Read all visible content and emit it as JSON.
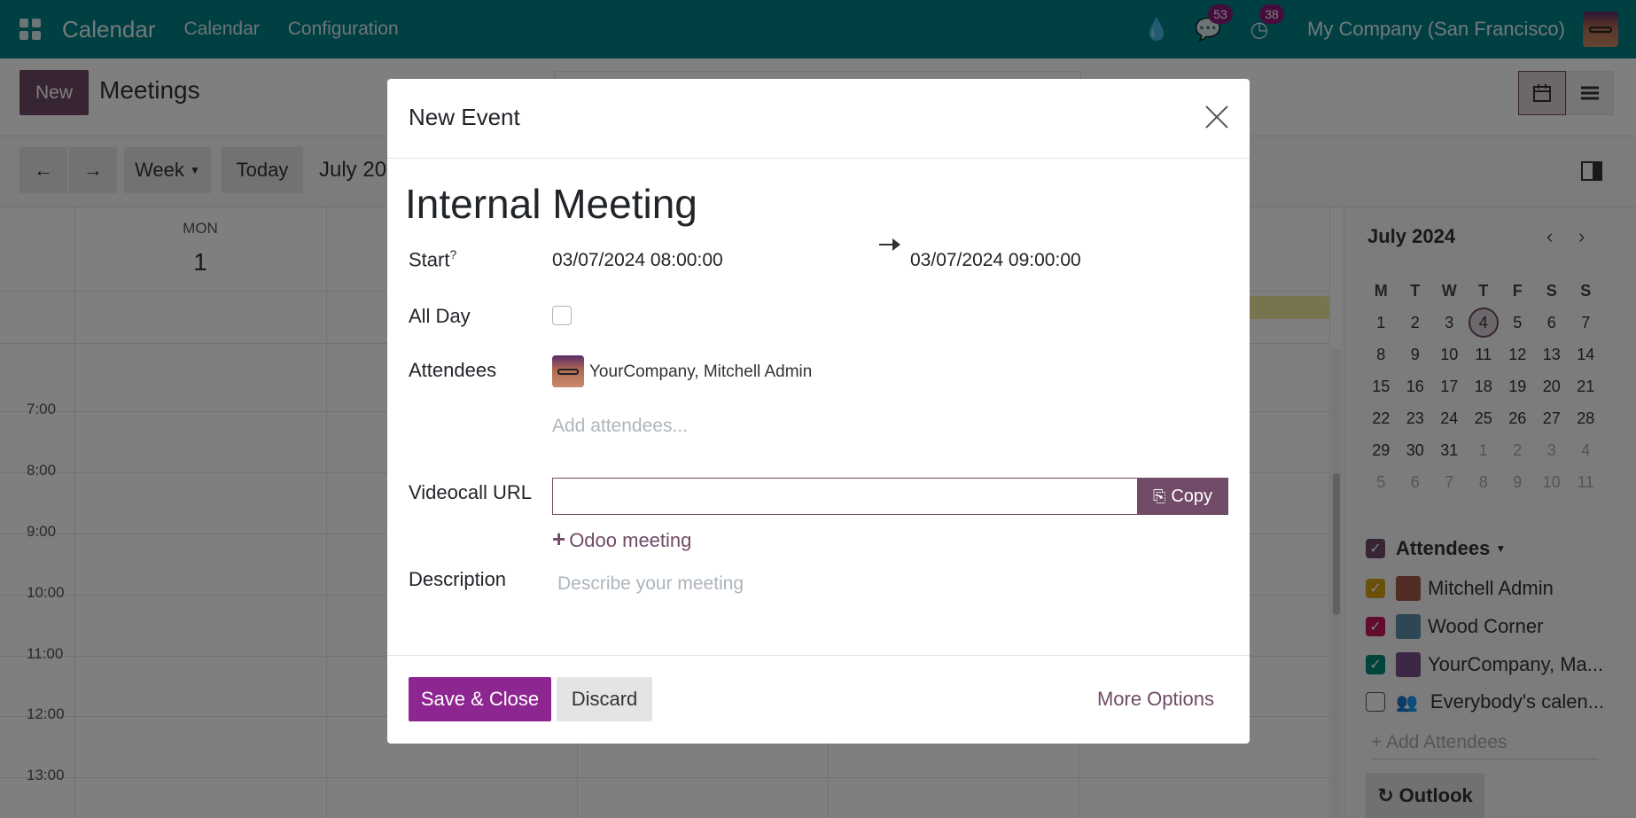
{
  "navbar": {
    "app_title": "Calendar",
    "links": [
      "Calendar",
      "Configuration"
    ],
    "messages_count": "53",
    "activities_count": "38",
    "company": "My Company (San Francisco)",
    "icons": [
      "apps-grid-icon",
      "water-drop-icon",
      "chat-icon",
      "clock-icon"
    ]
  },
  "control_panel": {
    "new_label": "New",
    "title": "Meetings"
  },
  "toolbar": {
    "scale_label": "Week",
    "today_label": "Today",
    "date_label": "July 20"
  },
  "calendar": {
    "day_name": "MON",
    "day_num": "1",
    "hours": [
      "7:00",
      "8:00",
      "9:00",
      "10:00",
      "11:00",
      "12:00",
      "13:00"
    ]
  },
  "sidebar": {
    "month_label": "July 2024",
    "weekday_heads": [
      "M",
      "T",
      "W",
      "T",
      "F",
      "S",
      "S"
    ],
    "weeks": [
      [
        "1",
        "2",
        "3",
        "4",
        "5",
        "6",
        "7"
      ],
      [
        "8",
        "9",
        "10",
        "11",
        "12",
        "13",
        "14"
      ],
      [
        "15",
        "16",
        "17",
        "18",
        "19",
        "20",
        "21"
      ],
      [
        "22",
        "23",
        "24",
        "25",
        "26",
        "27",
        "28"
      ],
      [
        "29",
        "30",
        "31",
        "1",
        "2",
        "3",
        "4"
      ],
      [
        "5",
        "6",
        "7",
        "8",
        "9",
        "10",
        "11"
      ]
    ],
    "today": "4",
    "filter_title": "Attendees",
    "filters": [
      {
        "label": "Mitchell Admin",
        "color": "#d4a017"
      },
      {
        "label": "Wood Corner",
        "color": "#c2185b"
      },
      {
        "label": "YourCompany, Ma...",
        "color": "#00897b"
      },
      {
        "label": "Everybody's calen...",
        "color": ""
      }
    ],
    "add_attendees": "+ Add Attendees",
    "outlook_label": "Outlook"
  },
  "modal": {
    "title": "New Event",
    "event_name": "Internal Meeting",
    "start_label": "Start",
    "start_help": "?",
    "start_value": "03/07/2024 08:00:00",
    "end_value": "03/07/2024 09:00:00",
    "allday_label": "All Day",
    "attendees_label": "Attendees",
    "attendee": "YourCompany, Mitchell Admin",
    "add_attendees_placeholder": "Add attendees...",
    "videocall_label": "Videocall URL",
    "copy_label": "Copy",
    "odoo_meeting_label": "Odoo meeting",
    "description_label": "Description",
    "description_placeholder": "Describe your meeting",
    "save_label": "Save & Close",
    "discard_label": "Discard",
    "more_label": "More Options"
  }
}
